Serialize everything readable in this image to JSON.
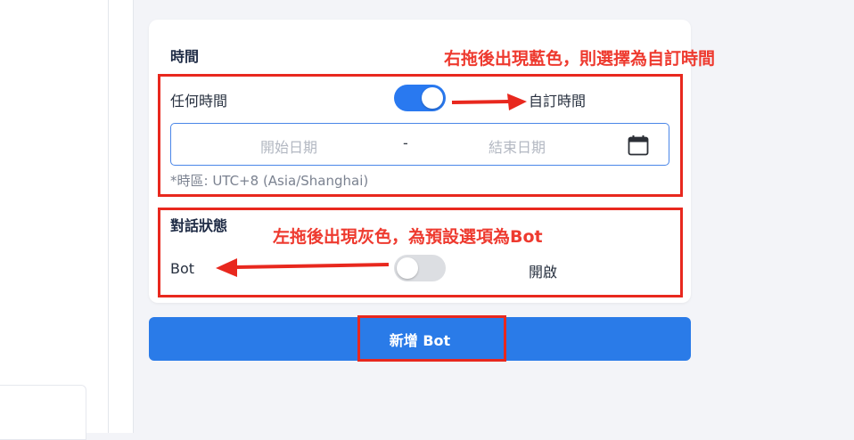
{
  "time_section": {
    "title": "時間",
    "any_time_label": "任何時間",
    "custom_time_label": "自訂時間",
    "toggle_on": true,
    "start_date_placeholder": "開始日期",
    "separator": "-",
    "end_date_placeholder": "結束日期",
    "timezone_note": "*時區: UTC+8 (Asia/Shanghai)"
  },
  "conversation_section": {
    "title": "對話狀態",
    "bot_label": "Bot",
    "open_label": "開啟",
    "toggle_on": false
  },
  "add_button_label": "新增 Bot",
  "annotations": {
    "time_note": "右拖後出現藍色，則選擇為自訂時間",
    "status_note": "左拖後出現灰色，為預設選項為Bot",
    "color": "#e8281e"
  },
  "colors": {
    "accent": "#2979f0",
    "toggle_off": "#dcdee2"
  },
  "icons": [
    "calendar-icon",
    "arrow-right-icon",
    "arrow-left-icon"
  ]
}
